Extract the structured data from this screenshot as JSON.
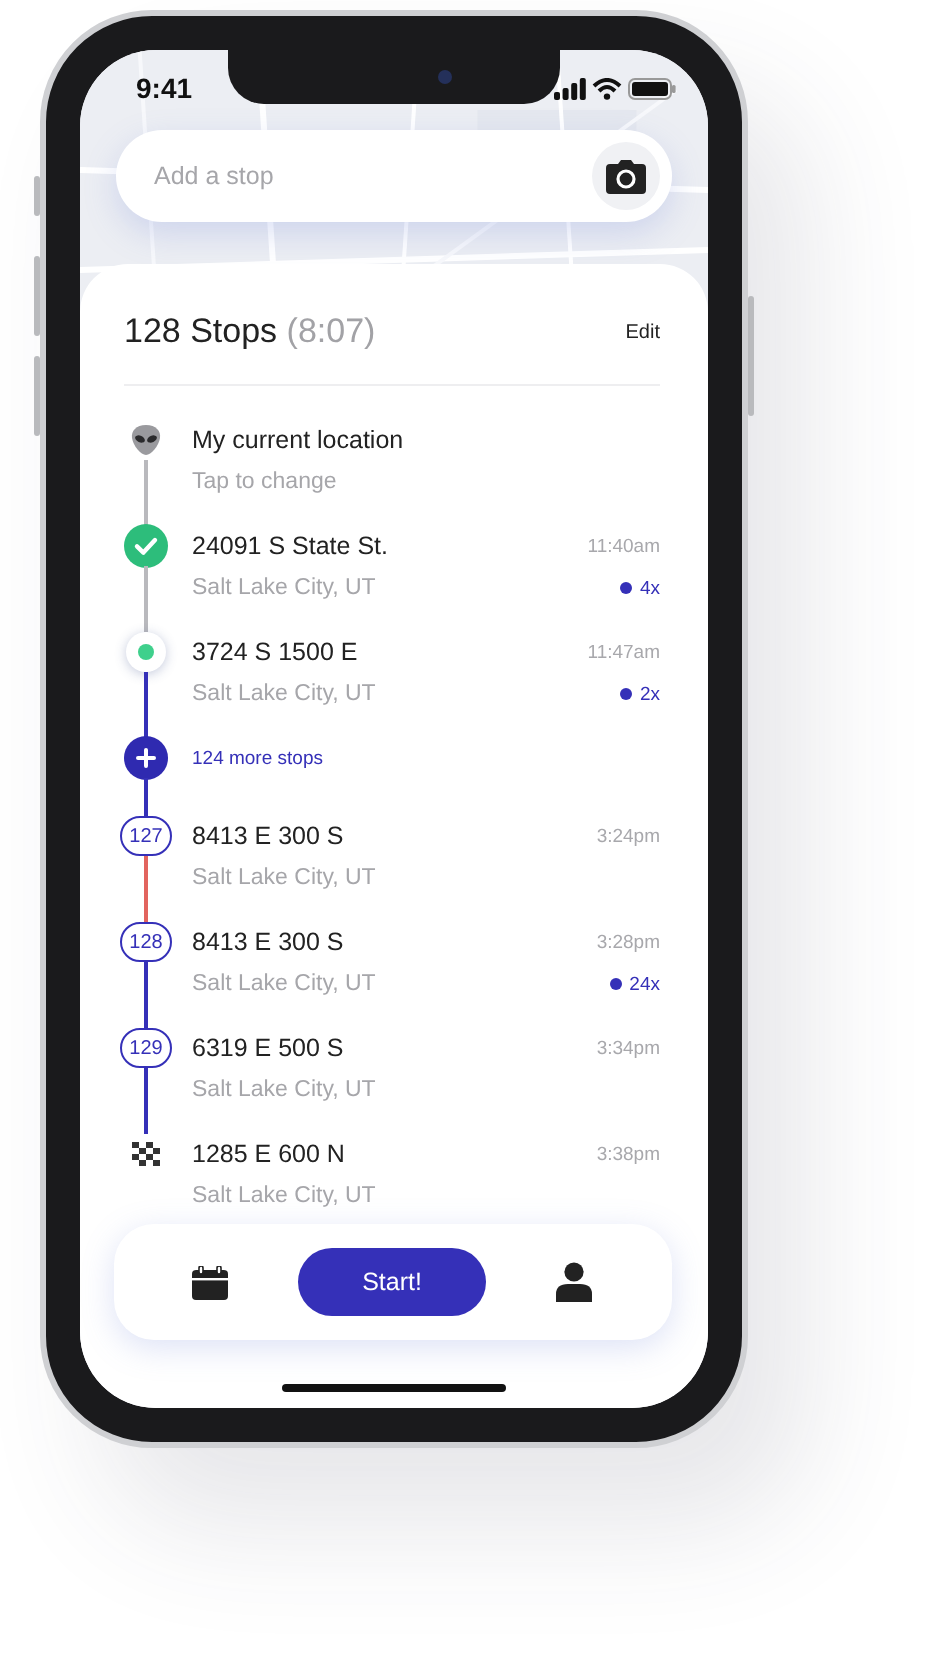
{
  "status_bar": {
    "time": "9:41"
  },
  "search": {
    "placeholder": "Add a stop"
  },
  "header": {
    "title": "128 Stops",
    "duration": "(8:07)",
    "edit": "Edit"
  },
  "stops": [
    {
      "kind": "current",
      "title": "My current location",
      "subtitle": "Tap to change",
      "color": "#b9b9bd"
    },
    {
      "kind": "done",
      "title": "24091 S State St.",
      "subtitle": "Salt Lake City, UT",
      "time": "11:40am",
      "count": "4x",
      "color": "#b9b9bd"
    },
    {
      "kind": "active",
      "title": "3724 S 1500 E",
      "subtitle": "Salt Lake City, UT",
      "time": "11:47am",
      "count": "2x",
      "color": "#3530b8"
    },
    {
      "kind": "more",
      "title": "124 more stops",
      "color": "#3530b8"
    },
    {
      "kind": "numbered",
      "number": "127",
      "title": "8413 E 300 S",
      "subtitle": "Salt Lake City, UT",
      "time": "3:24pm",
      "color": "#e2645e"
    },
    {
      "kind": "numbered",
      "number": "128",
      "title": "8413 E 300 S",
      "subtitle": "Salt Lake City, UT",
      "time": "3:28pm",
      "count": "24x",
      "color": "#3530b8"
    },
    {
      "kind": "numbered",
      "number": "129",
      "title": "6319 E 500 S",
      "subtitle": "Salt Lake City, UT",
      "time": "3:34pm",
      "color": "#3530b8"
    },
    {
      "kind": "finish",
      "title": "1285 E 600 N",
      "subtitle": "Salt Lake City, UT",
      "time": "3:38pm"
    }
  ],
  "bottom_nav": {
    "button": "Start!"
  }
}
